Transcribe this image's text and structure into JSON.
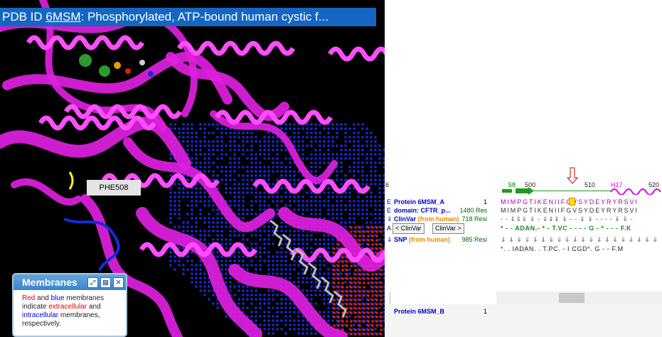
{
  "viewer": {
    "title_prefix": "PDB ID",
    "pdb_id": "6MSM",
    "title_rest": ": Phosphorylated, ATP-bound human cystic f...",
    "residue_label": "PHE508",
    "colors": {
      "protein": "#e020e0",
      "background": "#000000",
      "extracellular": "#e02000",
      "intracellular": "#1a2ad8"
    }
  },
  "membranes_panel": {
    "title": "Membranes",
    "buttons": [
      "expand-icon",
      "save-icon",
      "close-icon"
    ],
    "text_red": "Red",
    "text_and": " and ",
    "text_blue": "blue",
    "text_mid": " membranes indicate ",
    "text_extra": "extracellular",
    "text_and2": " and ",
    "text_intra": "intracellular",
    "text_end": " membranes, respectively."
  },
  "sequence_panel": {
    "ruler": {
      "r500": "500",
      "r510": "510",
      "r520": "520",
      "s8": "S8",
      "h17": "H17",
      "left": "6"
    },
    "rows": [
      {
        "gutter": "E",
        "name": "Protein 6MSM_A",
        "num": "1",
        "seq": "MIMPGTIKENIIFGVSYDEYRYRSVI"
      },
      {
        "gutter": "E",
        "name": "domain: CFTR_p...",
        "num": "1480 Res",
        "seq": "MIMPGTIKENIIFGVSYDEYRYRSVI"
      },
      {
        "gutter": "⇓",
        "name": "ClinVar",
        "source": "(from human)",
        "num": "718 Resi",
        "seq": "- - ⇓⇓⇓ ⇓ - ⇓⇓⇓ ⇓ - - ⇓ ⇓ - - - - ⇓ ⇓ -"
      },
      {
        "gutter": "A",
        "seq": "* - - ADAN.- * - T.VC - - - - G - * - - - F.K"
      },
      {
        "gutter": "⇓",
        "name": "SNP",
        "source": "(from human)",
        "num": "985 Resi",
        "seq": "⇓ ⇓ ⇓ ⇓ ⇓ ⇓ ⇓ ⇓ ⇓ ⇓ ⇓ ⇓ ⇓ ⇓ ⇓ ⇓ ⇓ ⇓ ⇓ ⇓"
      },
      {
        "gutter": "",
        "seq": "*. . IADAN. . T.PC. - I CGD*. G - - F.M"
      }
    ],
    "clinvar_prev": "< ClinVar",
    "clinvar_next": "ClinVar >",
    "chain_b": {
      "name": "Protein 6MSM_B",
      "num": "1"
    }
  }
}
